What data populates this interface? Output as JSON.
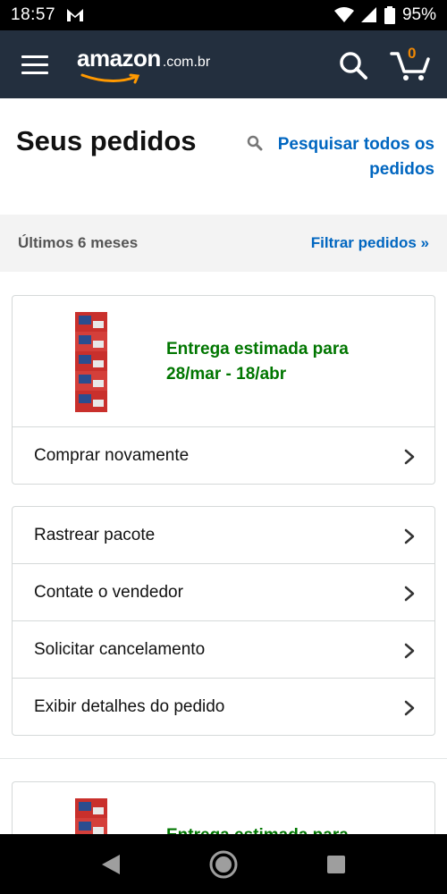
{
  "status_bar": {
    "time": "18:57",
    "battery": "95%"
  },
  "header": {
    "logo_text": "amazon",
    "logo_tld": ".com.br",
    "cart_count": "0"
  },
  "page": {
    "title": "Seus pedidos",
    "search_link": "Pesquisar todos os pedidos"
  },
  "filter": {
    "range_label": "Últimos 6 meses",
    "filter_link": "Filtrar pedidos »"
  },
  "orders": [
    {
      "delivery_line1": "Entrega estimada para",
      "delivery_line2": "28/mar - 18/abr",
      "buy_again": "Comprar novamente",
      "actions": [
        "Rastrear pacote",
        "Contate o vendedor",
        "Solicitar cancelamento",
        "Exibir detalhes do pedido"
      ]
    },
    {
      "delivery_line1": "Entrega estimada para"
    }
  ],
  "colors": {
    "header_bg": "#232f3e",
    "link": "#0066c0",
    "delivery": "#007600",
    "cart_accent": "#f08804"
  }
}
